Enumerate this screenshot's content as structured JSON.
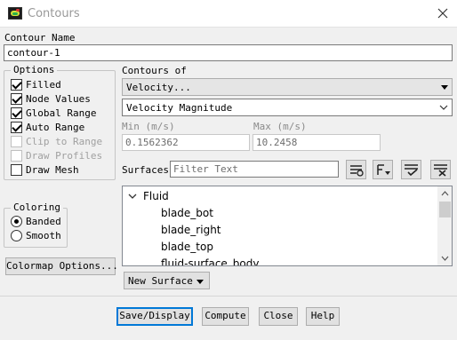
{
  "window": {
    "title": "Contours",
    "icon": "contour-app-icon"
  },
  "contour_name": {
    "label": "Contour Name",
    "value": "contour-1"
  },
  "options": {
    "legend": "Options",
    "items": [
      {
        "label": "Filled",
        "checked": true,
        "enabled": true
      },
      {
        "label": "Node Values",
        "checked": true,
        "enabled": true
      },
      {
        "label": "Global Range",
        "checked": true,
        "enabled": true
      },
      {
        "label": "Auto Range",
        "checked": true,
        "enabled": true
      },
      {
        "label": "Clip to Range",
        "checked": false,
        "enabled": false
      },
      {
        "label": "Draw Profiles",
        "checked": false,
        "enabled": false
      },
      {
        "label": "Draw Mesh",
        "checked": false,
        "enabled": true
      }
    ]
  },
  "contours_of": {
    "label": "Contours of",
    "category": "Velocity...",
    "quantity": "Velocity Magnitude"
  },
  "range": {
    "min_label": "Min (m/s)",
    "min_value": "0.1562362",
    "max_label": "Max (m/s)",
    "max_value": "10.2458"
  },
  "surfaces": {
    "label": "Surfaces",
    "filter_placeholder": "Filter Text",
    "toolbar_icons": [
      "filter-select-icon",
      "group-dropdown-icon",
      "select-all-icon",
      "deselect-all-icon"
    ],
    "group": "Fluid",
    "items": [
      "blade_bot",
      "blade_right",
      "blade_top",
      "fluid-surface_body"
    ]
  },
  "coloring": {
    "legend": "Coloring",
    "options": [
      {
        "label": "Banded",
        "selected": true
      },
      {
        "label": "Smooth",
        "selected": false
      }
    ]
  },
  "buttons": {
    "colormap": "Colormap Options...",
    "new_surface": "New Surface",
    "save_display": "Save/Display",
    "compute": "Compute",
    "close": "Close",
    "help": "Help"
  }
}
